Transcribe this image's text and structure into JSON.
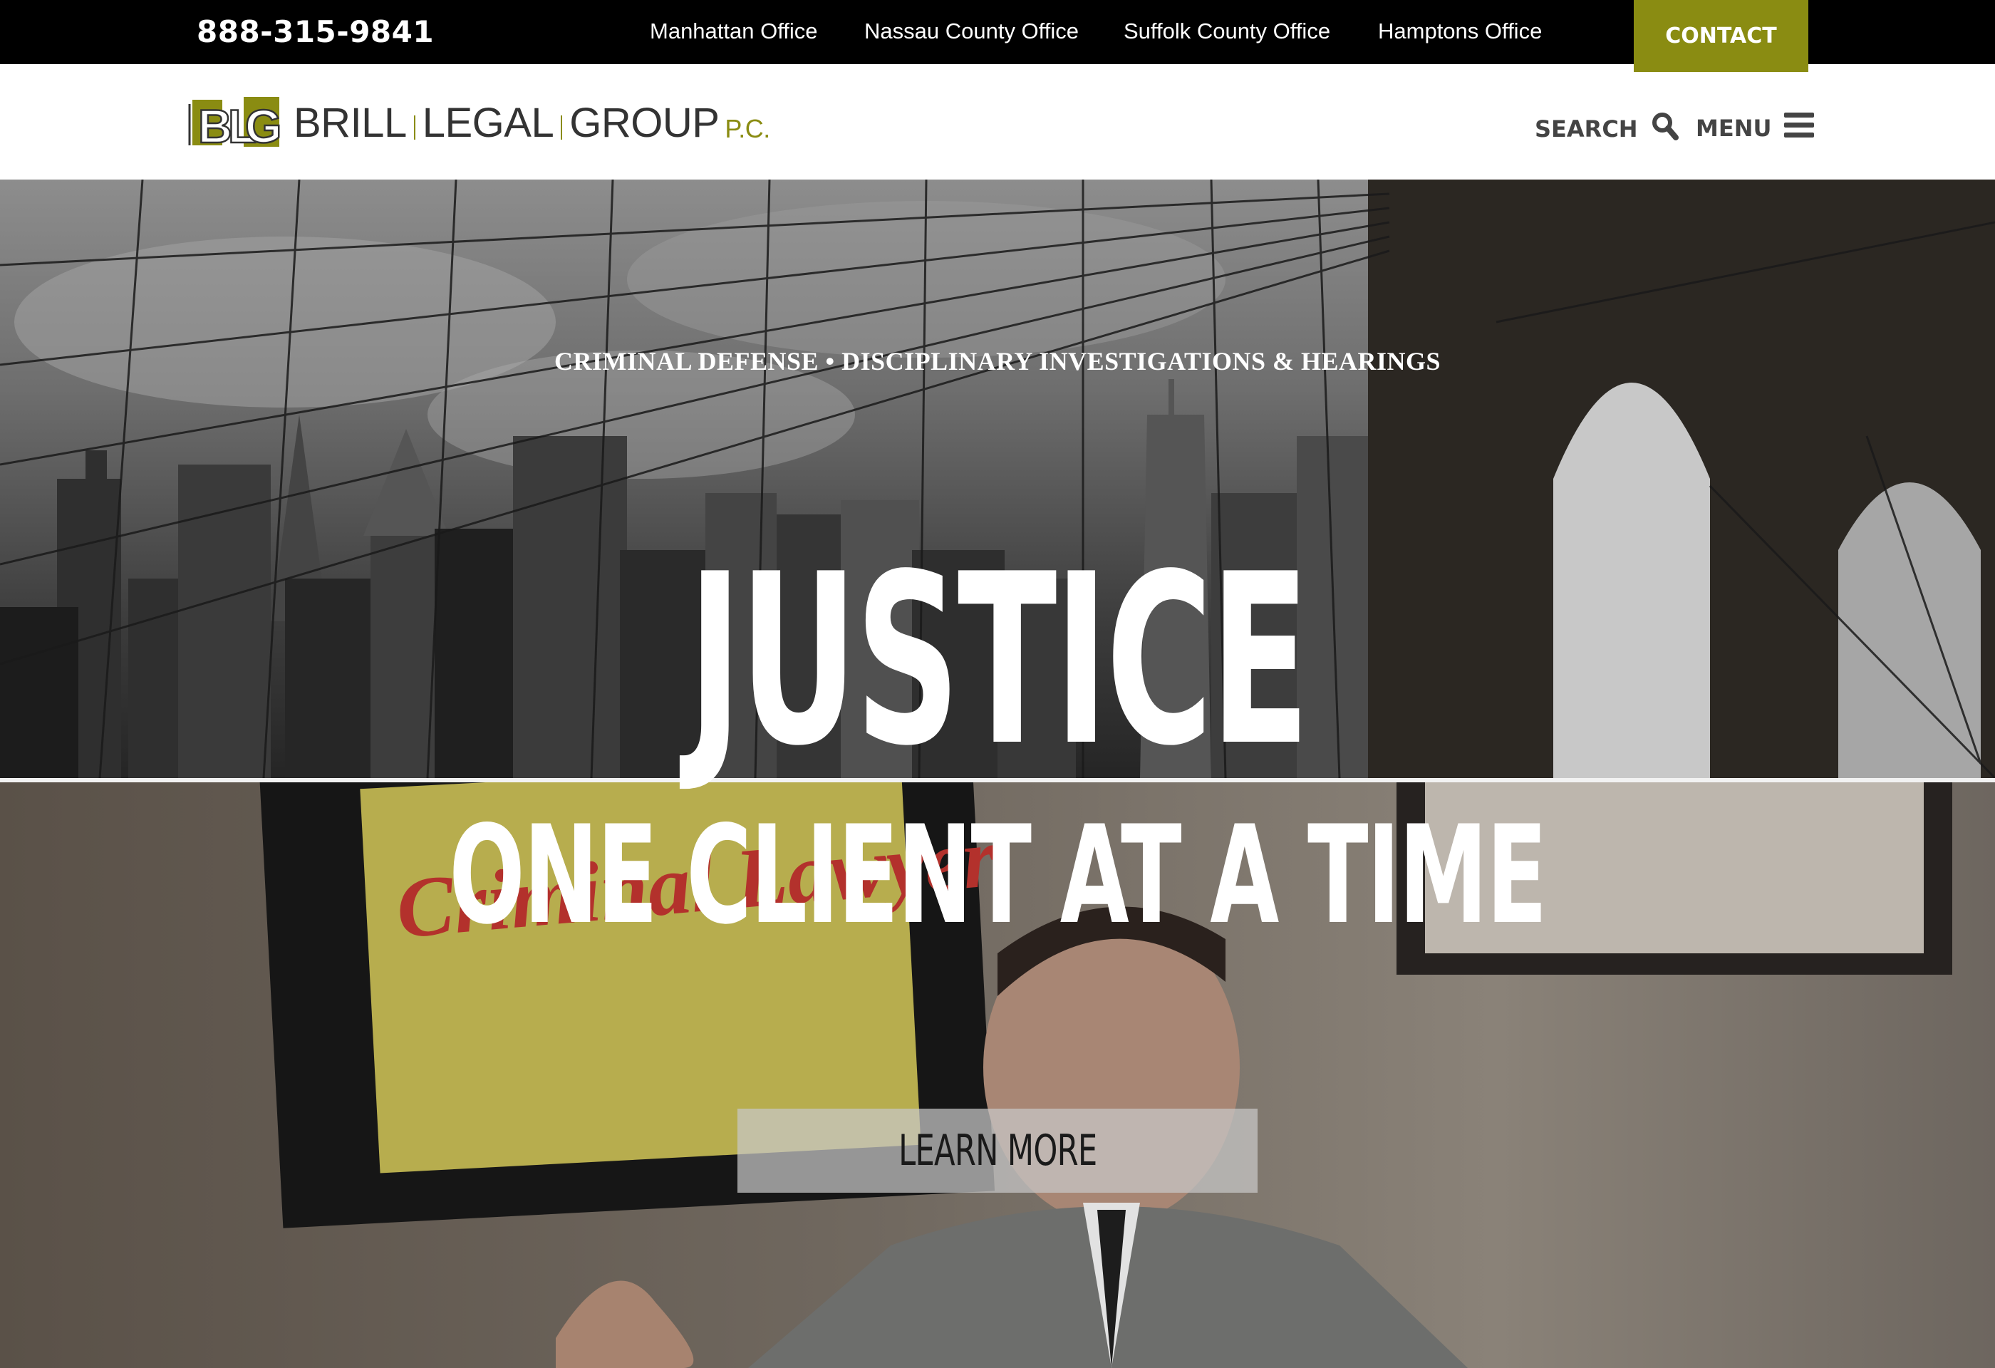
{
  "topbar": {
    "phone": "888-315-9841",
    "offices": [
      "Manhattan Office",
      "Nassau County Office",
      "Suffolk County Office",
      "Hamptons Office"
    ],
    "contact_label": "CONTACT"
  },
  "header": {
    "logo": {
      "mark": "BLG",
      "words": [
        "BRILL",
        "LEGAL",
        "GROUP"
      ],
      "suffix": "P.C."
    },
    "search_label": "SEARCH",
    "menu_label": "MENU"
  },
  "hero": {
    "tagline": "CRIMINAL DEFENSE • DISCIPLINARY INVESTIGATIONS & HEARINGS",
    "headline": "JUSTICE",
    "subheadline": "ONE CLIENT AT A TIME",
    "cta_label": "LEARN MORE",
    "poster_text": "Criminal Lawyer"
  },
  "colors": {
    "accent": "#8a8c12",
    "topbar_bg": "#000000",
    "header_bg": "#ffffff"
  },
  "icons": {
    "search": "search-icon",
    "menu": "hamburger-menu-icon"
  }
}
